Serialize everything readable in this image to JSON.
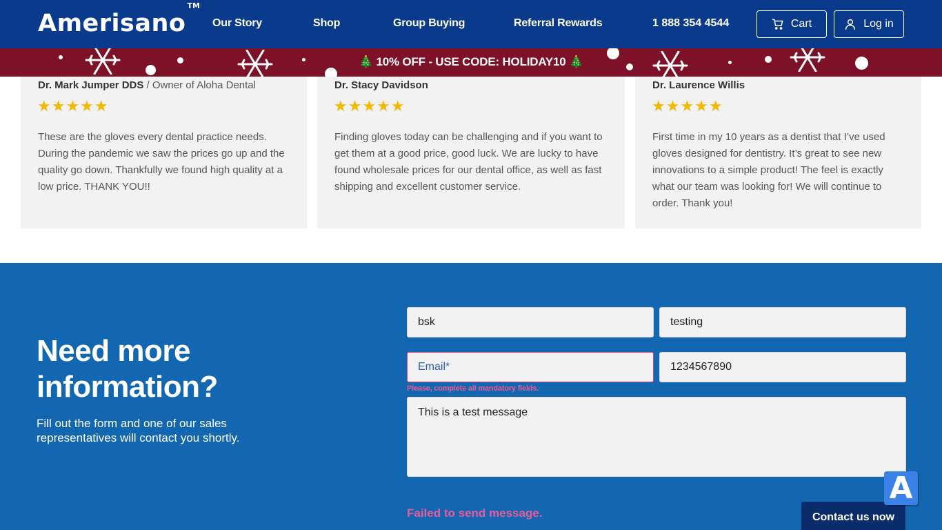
{
  "header": {
    "logo": "Amerisano",
    "logo_mark": "TM",
    "nav": [
      "Our Story",
      "Shop",
      "Group Buying",
      "Referral Rewards"
    ],
    "phone": "1 888 354 4544",
    "cart_label": "Cart",
    "login_label": "Log in",
    "brand_color": "#0a3a8c"
  },
  "promo": {
    "text": "🎄 10% OFF - USE CODE: HOLIDAY10 🎄",
    "bg_color": "#7d1128"
  },
  "reviews": [
    {
      "name": "Dr. Mark Jumper DDS",
      "role": " / Owner of Aloha Dental",
      "stars": "★★★★★",
      "text": "These are the gloves every dental practice needs. During the pandemic we saw the prices go up and the quality go down. Thankfully we found high quality at a low price. THANK YOU!!"
    },
    {
      "name": "Dr. Stacy Davidson",
      "role": "",
      "stars": "★★★★★",
      "text": "Finding gloves today can be challenging and if you want to get them at a good price, good luck. We are lucky to have found wholesale prices for our dental office, as well as fast shipping and excellent customer service."
    },
    {
      "name": "Dr. Laurence Willis",
      "role": "",
      "stars": "★★★★★",
      "text": "First time in my 10 years as a dentist that I’ve used gloves designed for dentistry. It’s great to see new innovations to a simple product! The feel is exactly what our team was looking for! We will continue to order. Thank you!"
    }
  ],
  "contact": {
    "title_line1": "Need more",
    "title_line2": "information?",
    "subtitle": "Fill out the form and one of our sales representatives will contact you shortly.",
    "first_name_value": "bsk",
    "last_name_value": "testing",
    "email_placeholder": "Email*",
    "email_value": "",
    "phone_value": "1234567890",
    "field_error": "Please, complete all mandatory fields.",
    "message_value": "This is a test message",
    "fail_message": "Failed to send message.",
    "contact_button": "Contact us now",
    "badge_letter": "A",
    "section_color": "#1366b0",
    "error_color": "#e95b9c"
  }
}
